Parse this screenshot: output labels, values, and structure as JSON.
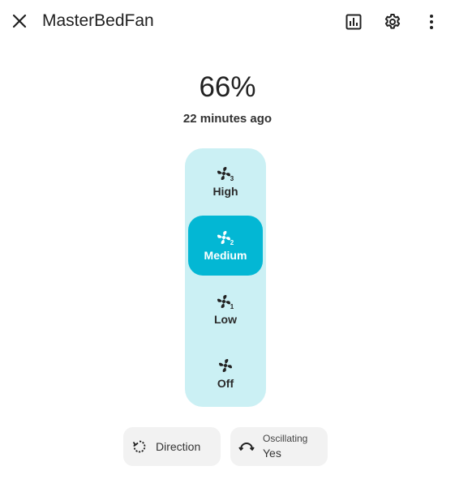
{
  "header": {
    "title": "MasterBedFan",
    "close_icon": "close-icon",
    "history_icon": "history-chart-icon",
    "settings_icon": "gear-icon",
    "more_icon": "more-vertical-icon"
  },
  "state": {
    "value": "66%",
    "last_changed": "22 minutes ago"
  },
  "speeds": {
    "active": "Medium",
    "accent_color": "#03b7d4",
    "pill_color": "#cbf0f4",
    "high": "High",
    "medium": "Medium",
    "low": "Low",
    "off": "Off"
  },
  "controls": {
    "direction_label": "Direction",
    "oscillating_label": "Oscillating",
    "oscillating_value": "Yes"
  }
}
